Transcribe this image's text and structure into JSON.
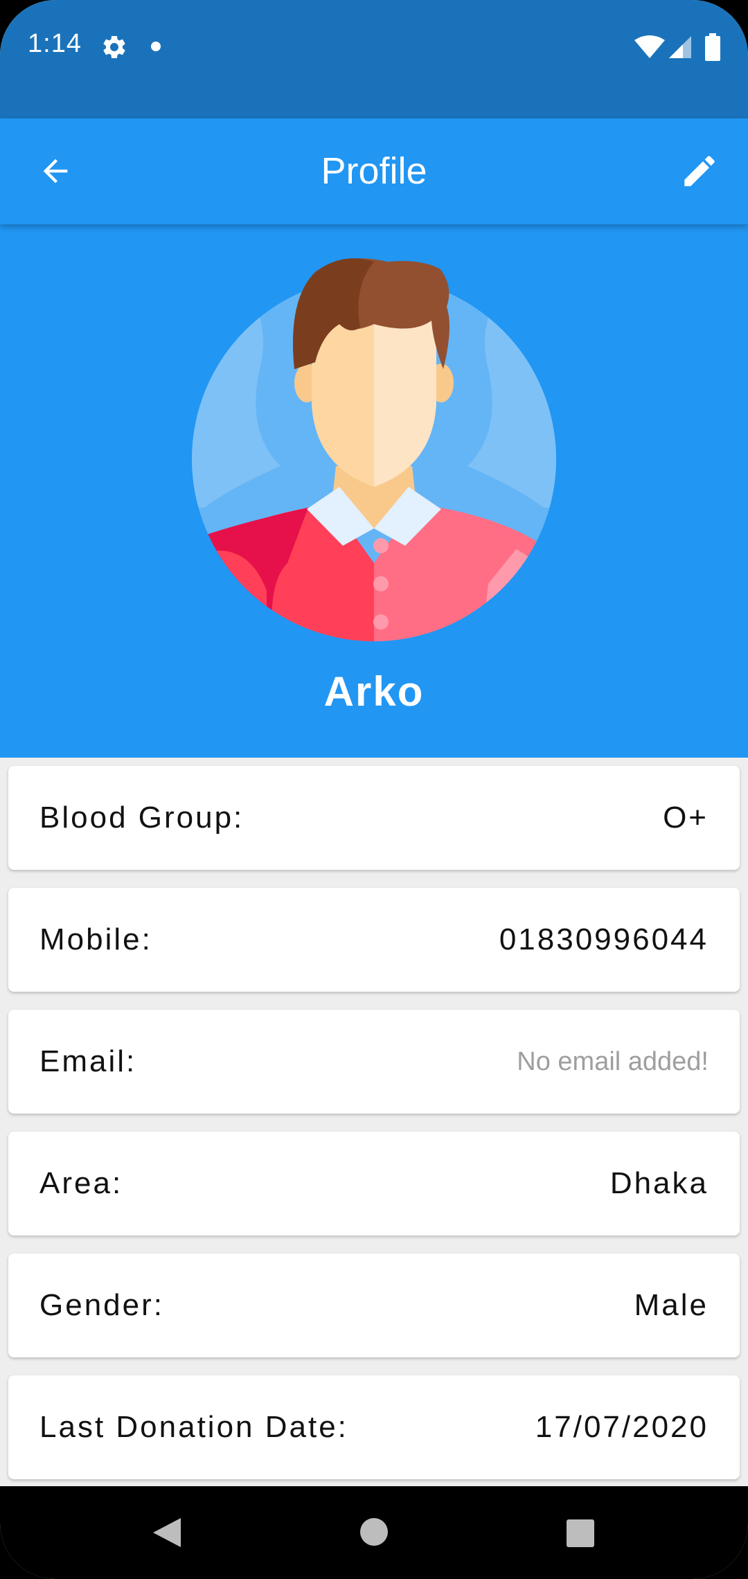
{
  "status_bar": {
    "time": "1:14",
    "icons": [
      "gear-icon",
      "notification-dot-icon",
      "wifi-icon",
      "signal-icon",
      "battery-icon"
    ]
  },
  "app_bar": {
    "title": "Profile",
    "back_icon": "arrow-back-icon",
    "edit_icon": "pencil-icon"
  },
  "profile": {
    "name": "Arko",
    "avatar": "avatar-male-icon"
  },
  "info": [
    {
      "label": "Blood Group:",
      "value": "O+"
    },
    {
      "label": "Mobile:",
      "value": "01830996044"
    },
    {
      "label": "Email:",
      "value": "No email added!"
    },
    {
      "label": "Area:",
      "value": "Dhaka"
    },
    {
      "label": "Gender:",
      "value": "Male"
    },
    {
      "label": "Last Donation Date:",
      "value": "17/07/2020"
    }
  ],
  "nav_bar": {
    "icons": [
      "nav-back-icon",
      "nav-home-icon",
      "nav-recents-icon"
    ]
  },
  "colors": {
    "status_bar": "#1A73BA",
    "primary": "#2196F3",
    "background": "#EEEEEE",
    "card": "#FFFFFF",
    "muted_text": "#9E9E9E"
  }
}
